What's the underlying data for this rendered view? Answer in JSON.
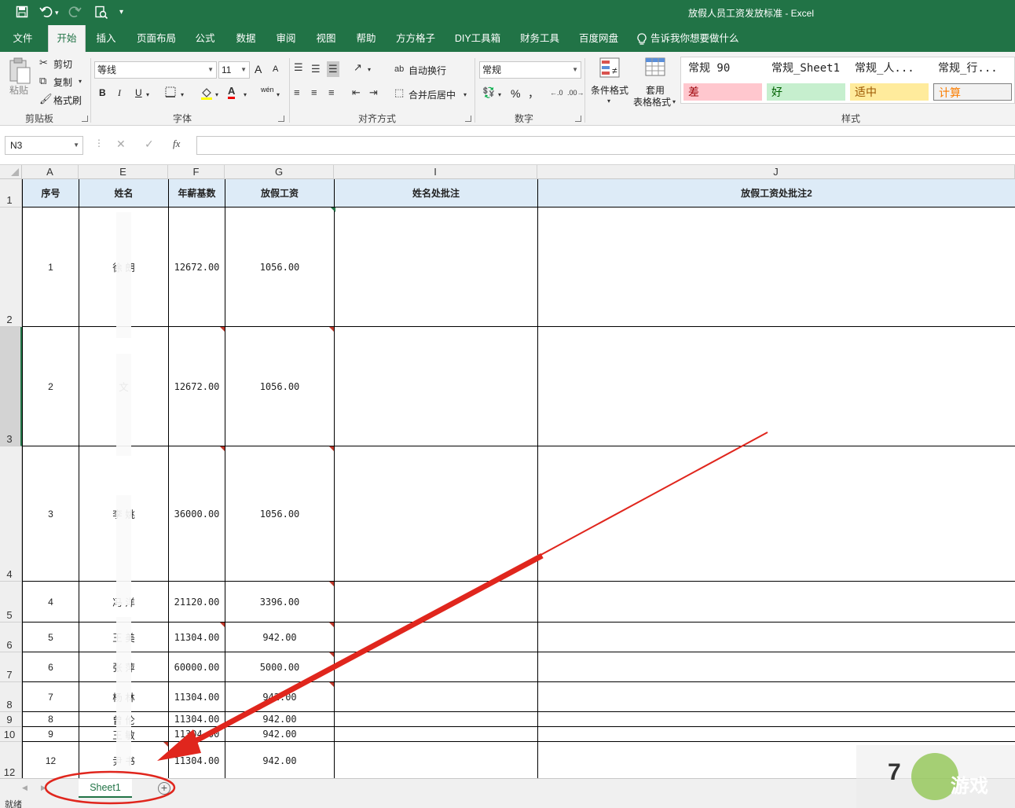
{
  "window": {
    "title": "放假人员工资发放标准  -  Excel"
  },
  "quick_access": {
    "save_icon": "save-icon",
    "undo_icon": "undo-icon",
    "redo_icon": "redo-icon",
    "preview_icon": "print-preview-icon",
    "customize_icon": "customize-icon"
  },
  "tabs": [
    "文件",
    "开始",
    "插入",
    "页面布局",
    "公式",
    "数据",
    "审阅",
    "视图",
    "帮助",
    "方方格子",
    "DIY工具箱",
    "财务工具",
    "百度网盘"
  ],
  "active_tab": "开始",
  "tell_me": "告诉我你想要做什么",
  "ribbon": {
    "clipboard": {
      "paste": "粘贴",
      "cut": "剪切",
      "copy": "复制",
      "format_painter": "格式刷",
      "label": "剪贴板"
    },
    "font": {
      "name": "等线",
      "size": "11",
      "grow": "A",
      "shrink": "A",
      "bold": "B",
      "italic": "I",
      "underline": "U",
      "wen": "wén",
      "label": "字体"
    },
    "align": {
      "wrap": "自动换行",
      "merge": "合并后居中",
      "label": "对齐方式"
    },
    "number": {
      "format": "常规",
      "percent": "%",
      "comma": "，",
      "label": "数字"
    },
    "styles": {
      "cond_format": "条件格式",
      "table_format_1": "套用",
      "table_format_2": "表格格式",
      "cells": [
        {
          "label": "常规 90",
          "color": "#222222",
          "bg": "#ffffff"
        },
        {
          "label": "常规_Sheet1",
          "color": "#222222",
          "bg": "#ffffff"
        },
        {
          "label": "常规_人...",
          "color": "#222222",
          "bg": "#ffffff"
        },
        {
          "label": "常规_行...",
          "color": "#222222",
          "bg": "#ffffff"
        },
        {
          "label": "差",
          "color": "#9c0006",
          "bg": "#ffc7ce"
        },
        {
          "label": "好",
          "color": "#006100",
          "bg": "#c6efce"
        },
        {
          "label": "适中",
          "color": "#9c5700",
          "bg": "#ffeb9c"
        },
        {
          "label": "计算",
          "color": "#fa7d00",
          "bg": "#f2f2f2"
        }
      ],
      "label": "样式"
    }
  },
  "formula_bar": {
    "name_box": "N3",
    "cancel": "✕",
    "enter": "✓",
    "fx": "fx",
    "value": ""
  },
  "columns": [
    "A",
    "E",
    "F",
    "G",
    "I",
    "J"
  ],
  "rows": [
    "1",
    "2",
    "3",
    "4",
    "5",
    "6",
    "7",
    "8",
    "9",
    "10",
    "12"
  ],
  "table": {
    "headers": [
      "序号",
      "姓名",
      "年薪基数",
      "放假工资",
      "姓名处批注",
      "放假工资处批注2"
    ],
    "rows": [
      [
        "1",
        "徐  朗",
        "12672.00",
        "1056.00",
        "",
        ""
      ],
      [
        "2",
        "   文",
        "12672.00",
        "1056.00",
        "",
        ""
      ],
      [
        "3",
        "李  姚",
        "36000.00",
        "1056.00",
        "",
        ""
      ],
      [
        "4",
        "冯  洋",
        "21120.00",
        "3396.00",
        "",
        ""
      ],
      [
        "5",
        "王  美",
        "11304.00",
        "942.00",
        "",
        ""
      ],
      [
        "6",
        "张  萍",
        "60000.00",
        "5000.00",
        "",
        ""
      ],
      [
        "7",
        "杨  林",
        "11304.00",
        "942.00",
        "",
        ""
      ],
      [
        "8",
        "曾  伦",
        "11304.00",
        "942.00",
        "",
        ""
      ],
      [
        "9",
        "王  敏",
        "11304.00",
        "942.00",
        "",
        ""
      ],
      [
        "12",
        "尹  书",
        "11304.00",
        "942.00",
        "",
        ""
      ]
    ]
  },
  "sheets": [
    {
      "name": "Sheet1",
      "active": true
    }
  ],
  "status": {
    "text": "就绪"
  },
  "annotation": {
    "color": "#e0261d"
  },
  "colors": {
    "excel_green": "#217346",
    "header_fill": "#ddebf7"
  }
}
